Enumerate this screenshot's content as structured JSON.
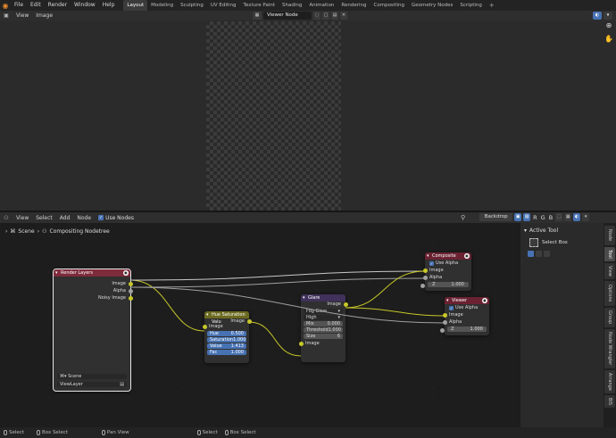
{
  "topbar": {
    "menus": [
      "File",
      "Edit",
      "Render",
      "Window",
      "Help"
    ],
    "workspaces": [
      "Layout",
      "Modeling",
      "Sculpting",
      "UV Editing",
      "Texture Paint",
      "Shading",
      "Animation",
      "Rendering",
      "Compositing",
      "Geometry Nodes",
      "Scripting"
    ],
    "active_workspace": "Layout",
    "add": "+"
  },
  "image_editor": {
    "menus": [
      "View",
      "Image"
    ],
    "image_name": "Viewer Node"
  },
  "node_editor": {
    "menus": [
      "View",
      "Select",
      "Add",
      "Node"
    ],
    "use_nodes_label": "Use Nodes",
    "backdrop_label": "Backdrop",
    "channels": [
      "R",
      "G",
      "B"
    ],
    "breadcrumb_scene": "Scene",
    "breadcrumb_tree": "Compositing Nodetree"
  },
  "nodes": {
    "render_layers": {
      "title": "Render Layers",
      "outputs": [
        "Image",
        "Alpha",
        "Noisy Image"
      ],
      "scene": "Scene",
      "view_layer": "ViewLayer"
    },
    "hue_sat": {
      "title": "Hue Saturation Valu",
      "output": "Image",
      "input": "Image",
      "fields": [
        {
          "label": "Hue",
          "value": "0.500"
        },
        {
          "label": "Saturation",
          "value": "1.000"
        },
        {
          "label": "Value",
          "value": "1.413"
        },
        {
          "label": "Fac",
          "value": "1.000"
        }
      ]
    },
    "glare": {
      "title": "Glare",
      "output": "Image",
      "type": "Fog Glow",
      "quality": "High",
      "fields": [
        {
          "label": "Mix",
          "value": "0.000"
        },
        {
          "label": "Threshold",
          "value": "1.000"
        },
        {
          "label": "Size",
          "value": "6"
        }
      ],
      "input": "Image"
    },
    "composite": {
      "title": "Composite",
      "use_alpha": "Use Alpha",
      "inputs": [
        "Image",
        "Alpha"
      ],
      "z_label": "Z",
      "z_value": "1.000"
    },
    "viewer": {
      "title": "Viewer",
      "use_alpha": "Use Alpha",
      "inputs": [
        "Image",
        "Alpha"
      ],
      "z_label": "Z",
      "z_value": "1.000"
    }
  },
  "side_panel": {
    "header": "Active Tool",
    "tool": "Select Box",
    "tabs": [
      "Node",
      "Tool",
      "View",
      "Options",
      "Group",
      "Node Wrangler",
      "Arrange",
      "BIS"
    ],
    "active_tab": "Tool"
  },
  "statusbar": {
    "items": [
      "Select",
      "Box Select",
      "Pan View",
      "Select",
      "Box Select"
    ]
  }
}
